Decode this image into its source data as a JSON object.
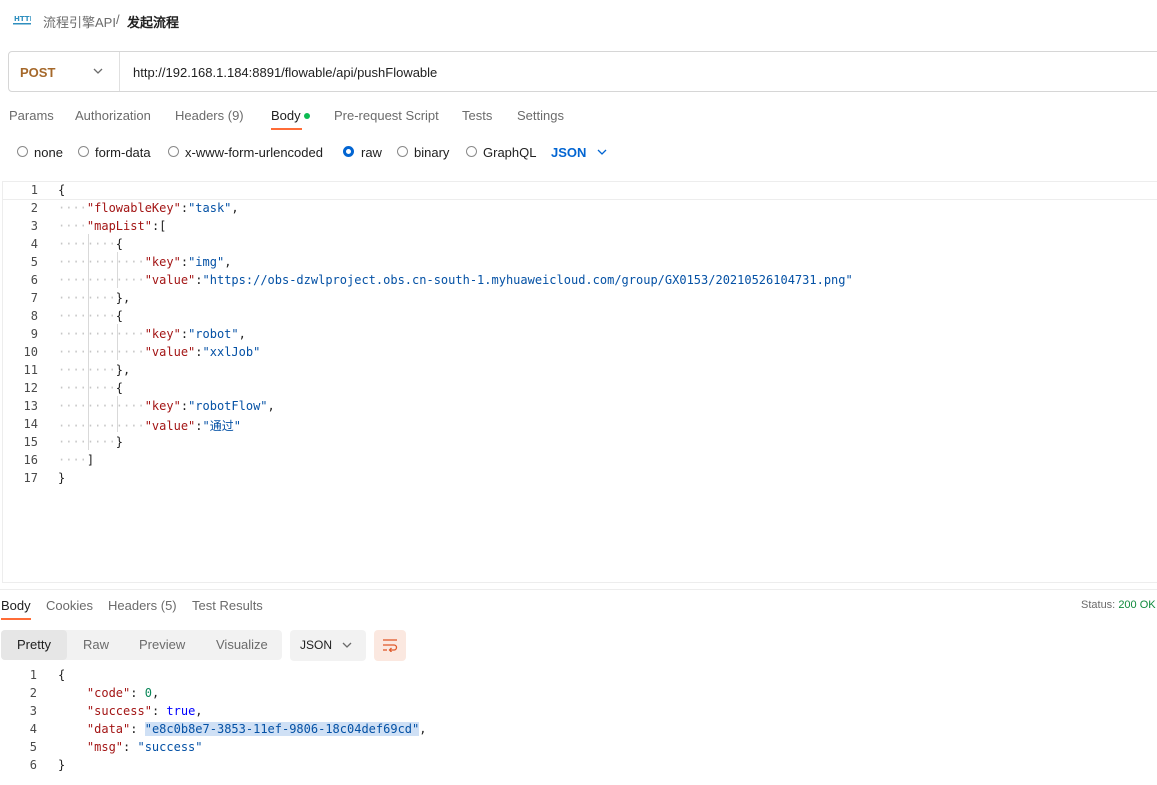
{
  "breadcrumb": {
    "icon": "http-icon",
    "collection": "流程引擎API",
    "separator": "/",
    "request": "发起流程"
  },
  "request": {
    "method": "POST",
    "url": "http://192.168.1.184:8891/flowable/api/pushFlowable"
  },
  "request_tabs": {
    "params": "Params",
    "authorization": "Authorization",
    "headers": "Headers (9)",
    "body": "Body",
    "prerequest": "Pre-request Script",
    "tests": "Tests",
    "settings": "Settings"
  },
  "body_types": {
    "none": "none",
    "form_data": "form-data",
    "urlencoded": "x-www-form-urlencoded",
    "raw": "raw",
    "binary": "binary",
    "graphql": "GraphQL",
    "selected": "raw",
    "language": "JSON"
  },
  "request_body": {
    "line_numbers": [
      "1",
      "2",
      "3",
      "4",
      "5",
      "6",
      "7",
      "8",
      "9",
      "10",
      "11",
      "12",
      "13",
      "14",
      "15",
      "16",
      "17"
    ],
    "flowableKey_key": "\"flowableKey\"",
    "flowableKey_val": "\"task\"",
    "mapList_key": "\"mapList\"",
    "key": "\"key\"",
    "value": "\"value\"",
    "item1_key": "\"img\"",
    "item1_value": "\"https://obs-dzwlproject.obs.cn-south-1.myhuaweicloud.com/group/GX0153/20210526104731.png\"",
    "item2_key": "\"robot\"",
    "item2_value": "\"xxlJob\"",
    "item3_key": "\"robotFlow\"",
    "item3_value": "\"通过\""
  },
  "response_tabs": {
    "body": "Body",
    "cookies": "Cookies",
    "headers": "Headers (5)",
    "test_results": "Test Results"
  },
  "status": {
    "label": "Status:",
    "value": "200 OK"
  },
  "view_modes": {
    "pretty": "Pretty",
    "raw": "Raw",
    "preview": "Preview",
    "visualize": "Visualize",
    "format": "JSON"
  },
  "response_body": {
    "line_numbers": [
      "1",
      "2",
      "3",
      "4",
      "5",
      "6"
    ],
    "code_key": "\"code\"",
    "code_val": "0",
    "success_key": "\"success\"",
    "success_val": "true",
    "data_key": "\"data\"",
    "data_val": "\"e8c0b8e7-3853-11ef-9806-18c04def69cd\"",
    "msg_key": "\"msg\"",
    "msg_val": "\"success\""
  },
  "colors": {
    "accent": "#ff6c37",
    "method": "#a5682a",
    "link": "#0265d2",
    "status_ok": "#0f8a3c"
  }
}
